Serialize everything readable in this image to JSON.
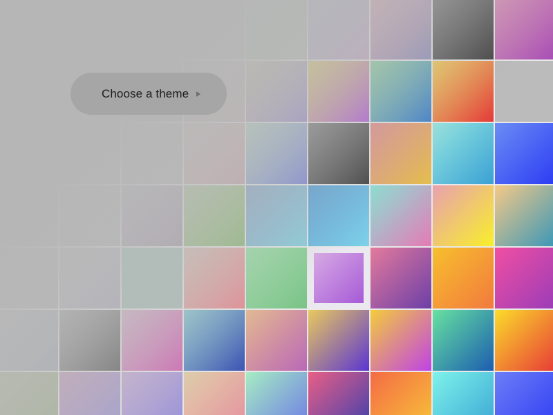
{
  "prompt": {
    "label": "Choose a theme",
    "icon": "chevron-right-icon"
  },
  "selected_theme_index": 41,
  "themes": [
    {
      "from": "#c7c7c7",
      "to": "#bdbdbd"
    },
    {
      "from": "#c8c4c4",
      "to": "#bcbcbc"
    },
    {
      "from": "#c4c6c9",
      "to": "#bbbcc0"
    },
    {
      "from": "#cbc8c8",
      "to": "#c2bfbf"
    },
    {
      "from": "#a9ccb0",
      "to": "#b6c0b1"
    },
    {
      "from": "#b5b7d4",
      "to": "#c3a8c3"
    },
    {
      "from": "#d7a7b3",
      "to": "#8d8cb9"
    },
    {
      "from": "#6e6e6e",
      "to": "#3b3b3b"
    },
    {
      "from": "#d887b3",
      "to": "#a750b5"
    },
    {
      "from": "#c7c7c7",
      "to": "#bdbdbd"
    },
    {
      "from": "#c6c6c6",
      "to": "#bdbdbd"
    },
    {
      "from": "#c2c3c7",
      "to": "#b6b8c1"
    },
    {
      "from": "#d2c4c4",
      "to": "#c2b0b5"
    },
    {
      "from": "#c9c6a7",
      "to": "#9a8bd0"
    },
    {
      "from": "#e3d36a",
      "to": "#b05ad9"
    },
    {
      "from": "#8ed3a0",
      "to": "#3b7ccc"
    },
    {
      "from": "#f2cc52",
      "to": "#e23c3c"
    },
    {
      "from": "#bbbbbb",
      "to": "#bbbbbb"
    },
    {
      "from": "#c7c7c7",
      "to": "#bdbdbd"
    },
    {
      "from": "#c6c6c6",
      "to": "#bdbdbd"
    },
    {
      "from": "#c3c3c3",
      "to": "#bababa"
    },
    {
      "from": "#d6c3c3",
      "to": "#c9a7ad"
    },
    {
      "from": "#b6d6c6",
      "to": "#7c85d8"
    },
    {
      "from": "#7a7a7a",
      "to": "#3d3d3d"
    },
    {
      "from": "#e28d8d",
      "to": "#e2bf4f"
    },
    {
      "from": "#94e6e0",
      "to": "#3aa1d4"
    },
    {
      "from": "#6b8cf4",
      "to": "#2c3cf3"
    },
    {
      "from": "#c4c4c4",
      "to": "#bbbbbb"
    },
    {
      "from": "#c3c3c3",
      "to": "#bababa"
    },
    {
      "from": "#bcb5c0",
      "to": "#aaa2ae"
    },
    {
      "from": "#b4c9a5",
      "to": "#92bc7e"
    },
    {
      "from": "#8eaacb",
      "to": "#8acfdc"
    },
    {
      "from": "#5aa0d7",
      "to": "#7fd2e9"
    },
    {
      "from": "#89e1d4",
      "to": "#e57ab6"
    },
    {
      "from": "#e8a0b0",
      "to": "#f8f02a"
    },
    {
      "from": "#f4c987",
      "to": "#3a97b7"
    },
    {
      "from": "#c2c2c2",
      "to": "#b9b9b9"
    },
    {
      "from": "#c3c3c3",
      "to": "#b3b0be"
    },
    {
      "from": "#a9c9bd",
      "to": "#b1c0bd"
    },
    {
      "from": "#d7c4b9",
      "to": "#e58c94"
    },
    {
      "from": "#9be0a8",
      "to": "#7bc287"
    },
    {
      "from": "#d8a9e6",
      "to": "#a65bd6"
    },
    {
      "from": "#e37a9c",
      "to": "#6c3fa8"
    },
    {
      "from": "#f7bf2e",
      "to": "#f27a3d"
    },
    {
      "from": "#f04fa2",
      "to": "#9b3cb8"
    },
    {
      "from": "#c0c0c0",
      "to": "#a8b0bb"
    },
    {
      "from": "#a9a9a9",
      "to": "#6b6b6b"
    },
    {
      "from": "#d6b9cb",
      "to": "#d06db5"
    },
    {
      "from": "#8fc9d1",
      "to": "#3f55b3"
    },
    {
      "from": "#e6b98f",
      "to": "#b968b7"
    },
    {
      "from": "#e9c95d",
      "to": "#5b35d2"
    },
    {
      "from": "#f4cc3b",
      "to": "#c042e6"
    },
    {
      "from": "#66e2a0",
      "to": "#1c5db0"
    },
    {
      "from": "#fbdc2b",
      "to": "#e73b37"
    },
    {
      "from": "#b7c1a9",
      "to": "#a9b59a"
    },
    {
      "from": "#c9a6c2",
      "to": "#9f9fd2"
    },
    {
      "from": "#c9b2d6",
      "to": "#9590d9"
    },
    {
      "from": "#e2cfa9",
      "to": "#e48f9f"
    },
    {
      "from": "#a6ecc3",
      "to": "#6c79e6"
    },
    {
      "from": "#e95f86",
      "to": "#3a3fae"
    },
    {
      "from": "#f46b45",
      "to": "#f8c538"
    },
    {
      "from": "#7df3ea",
      "to": "#39a3d4"
    },
    {
      "from": "#6d7ef7",
      "to": "#2d3bf2"
    }
  ]
}
